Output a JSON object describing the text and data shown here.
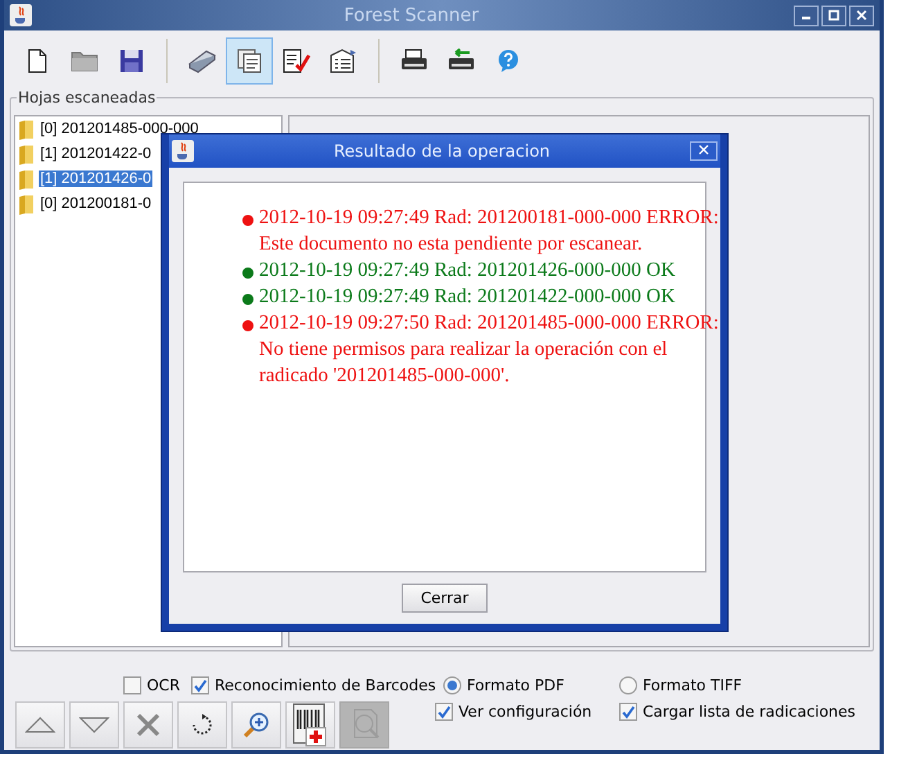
{
  "window": {
    "title": "Forest Scanner"
  },
  "toolbar": [
    {
      "kind": "new",
      "selected": false
    },
    {
      "kind": "open",
      "selected": false
    },
    {
      "kind": "save",
      "selected": false
    },
    {
      "kind": "separator"
    },
    {
      "kind": "scan",
      "selected": false
    },
    {
      "kind": "pages",
      "selected": true
    },
    {
      "kind": "edit",
      "selected": false
    },
    {
      "kind": "properties",
      "selected": false
    },
    {
      "kind": "separator"
    },
    {
      "kind": "print",
      "selected": false
    },
    {
      "kind": "print-send",
      "selected": false
    },
    {
      "kind": "help",
      "selected": false
    }
  ],
  "panel": {
    "legend": "Hojas escaneadas"
  },
  "tree": [
    {
      "label": "[0] 201201485-000-000",
      "selected": false
    },
    {
      "label": "[1] 201201422-0",
      "selected": false
    },
    {
      "label": "[1] 201201426-0",
      "selected": true
    },
    {
      "label": "[0] 201200181-0",
      "selected": false
    }
  ],
  "dialog": {
    "title": "Resultado de la operacion",
    "button": "Cerrar",
    "messages": [
      {
        "color": "#ee1111",
        "lines": [
          "2012-10-19 09:27:49 Rad: 201200181-000-000 ERROR:",
          "Este documento no esta pendiente por escanear."
        ]
      },
      {
        "color": "#0b7a1a",
        "lines": [
          "2012-10-19 09:27:49 Rad: 201201426-000-000 OK"
        ]
      },
      {
        "color": "#0b7a1a",
        "lines": [
          "2012-10-19 09:27:49 Rad: 201201422-000-000 OK"
        ]
      },
      {
        "color": "#ee1111",
        "lines": [
          "2012-10-19 09:27:50 Rad: 201201485-000-000 ERROR:",
          "No tiene permisos para realizar la operación con el",
          "radicado '201201485-000-000'."
        ]
      }
    ]
  },
  "options": {
    "ocr": {
      "label": "OCR",
      "checked": false
    },
    "barcodes": {
      "label": "Reconocimiento de Barcodes",
      "checked": true
    },
    "format_pdf": {
      "label": "Formato PDF",
      "selected": true
    },
    "format_tiff": {
      "label": "Formato TIFF",
      "selected": false
    },
    "show_config": {
      "label": "Ver configuración",
      "checked": true
    },
    "load_list": {
      "label": "Cargar lista de radicaciones",
      "checked": true
    }
  },
  "actions": [
    {
      "kind": "up",
      "disabled": false
    },
    {
      "kind": "down",
      "disabled": false
    },
    {
      "kind": "delete",
      "disabled": false
    },
    {
      "kind": "rotate",
      "disabled": false
    },
    {
      "kind": "zoom",
      "disabled": false
    },
    {
      "kind": "barcode",
      "disabled": false
    },
    {
      "kind": "ocr",
      "disabled": true
    }
  ]
}
